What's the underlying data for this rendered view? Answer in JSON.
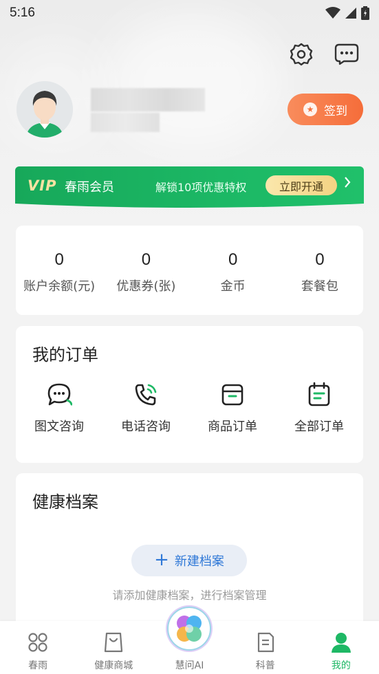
{
  "status_bar": {
    "time": "5:16"
  },
  "profile": {},
  "checkin": {
    "label": "签到"
  },
  "vip": {
    "logo": "VIP",
    "title": "春雨会员",
    "desc": "解锁10项优惠特权",
    "button": "立即开通"
  },
  "stats": [
    {
      "value": "0",
      "label": "账户余额(元)"
    },
    {
      "value": "0",
      "label": "优惠券(张)"
    },
    {
      "value": "0",
      "label": "金币"
    },
    {
      "value": "0",
      "label": "套餐包"
    }
  ],
  "orders": {
    "title": "我的订单",
    "items": [
      {
        "label": "图文咨询",
        "icon": "chat-icon"
      },
      {
        "label": "电话咨询",
        "icon": "phone-icon"
      },
      {
        "label": "商品订单",
        "icon": "box-icon"
      },
      {
        "label": "全部订单",
        "icon": "calendar-icon"
      }
    ]
  },
  "health": {
    "title": "健康档案",
    "button": "新建档案",
    "hint": "请添加健康档案，进行档案管理"
  },
  "tabs": [
    {
      "label": "春雨",
      "icon": "grid-icon"
    },
    {
      "label": "健康商城",
      "icon": "bag-icon"
    },
    {
      "label": "慧问AI",
      "icon": "ai-icon"
    },
    {
      "label": "科普",
      "icon": "document-icon"
    },
    {
      "label": "我的",
      "icon": "person-icon",
      "active": true
    }
  ],
  "colors": {
    "accent_green": "#1eb865",
    "checkin_orange": "#f56d3a",
    "link_blue": "#2f78d7"
  }
}
